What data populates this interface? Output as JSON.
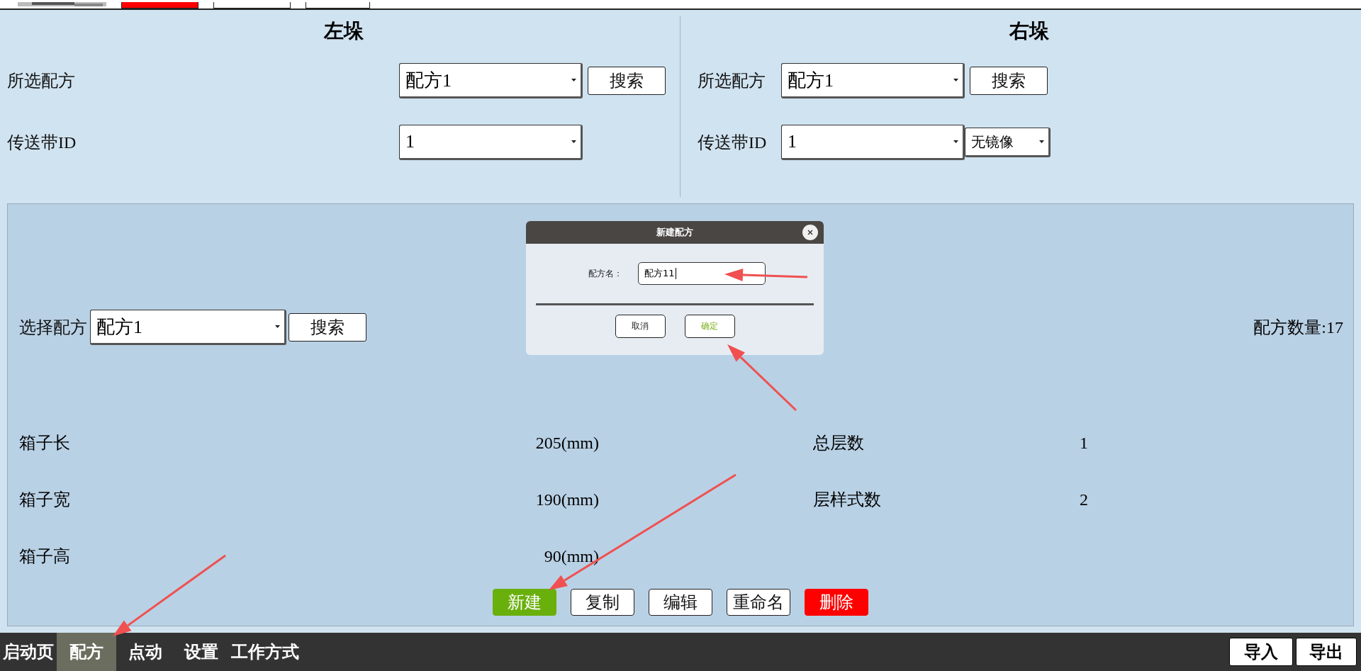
{
  "top_strip": {
    "buttons": [
      {
        "kind": "alert"
      },
      {
        "kind": "plain"
      },
      {
        "kind": "plain"
      }
    ]
  },
  "left_stack": {
    "title": "左垛",
    "recipe_label": "所选配方",
    "recipe_value": "配方1",
    "search": "搜索",
    "conveyor_label": "传送带ID",
    "conveyor_value": "1"
  },
  "right_stack": {
    "title": "右垛",
    "recipe_label": "所选配方",
    "recipe_value": "配方1",
    "search": "搜索",
    "conveyor_label": "传送带ID",
    "conveyor_value": "1",
    "mirror_value": "无镜像"
  },
  "details": {
    "select_label": "选择配方",
    "select_value": "配方1",
    "search": "搜索",
    "count": "配方数量:17",
    "fields": [
      {
        "label": "箱子长",
        "value": "205(mm)"
      },
      {
        "label": "箱子宽",
        "value": "190(mm)"
      },
      {
        "label": "箱子高",
        "value": "90(mm)"
      }
    ],
    "right_fields": [
      {
        "label": "总层数",
        "value": "1"
      },
      {
        "label": "层样式数",
        "value": "2"
      }
    ],
    "actions": [
      {
        "label": "新建",
        "kind": "primary"
      },
      {
        "label": "复制",
        "kind": "plain"
      },
      {
        "label": "编辑",
        "kind": "plain"
      },
      {
        "label": "重命名",
        "kind": "plain"
      },
      {
        "label": "删除",
        "kind": "danger"
      }
    ]
  },
  "dialog": {
    "title": "新建配方",
    "name_label": "配方名：",
    "name_value": "配方11",
    "buttons": [
      {
        "label": "取消",
        "kind": "plain"
      },
      {
        "label": "确定",
        "kind": "confirm"
      }
    ]
  },
  "nav": {
    "tabs": [
      {
        "label": "启动页",
        "selected": false
      },
      {
        "label": "配方",
        "selected": true
      },
      {
        "label": "点动",
        "selected": false
      },
      {
        "label": "设置",
        "selected": false
      },
      {
        "label": "工作方式",
        "selected": false
      }
    ],
    "buttons": [
      "导入",
      "导出"
    ]
  }
}
